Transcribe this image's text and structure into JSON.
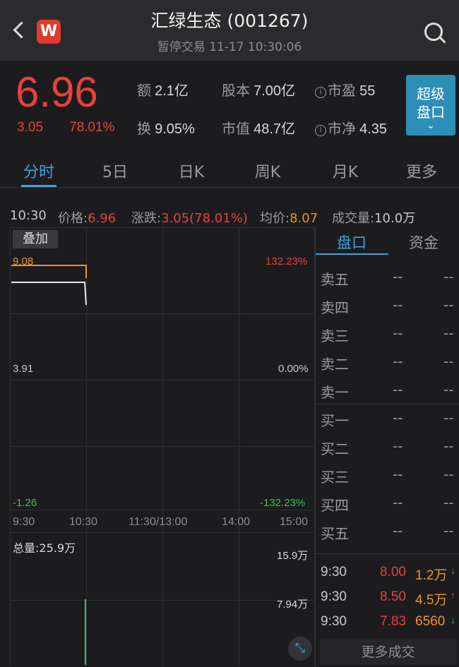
{
  "header": {
    "title": "汇绿生态 (001267)",
    "subtitle": "暂停交易 11-17 10:30:06",
    "logo_letter": "W"
  },
  "quote": {
    "price": "6.96",
    "change": "3.05",
    "change_pct": "78.01%",
    "turnover_amount_label": "额",
    "turnover_amount": "2.1亿",
    "turnover_rate_label": "换",
    "turnover_rate": "9.05%",
    "share_capital_label": "股本",
    "share_capital": "7.00亿",
    "market_value_label": "市值",
    "market_value": "48.7亿",
    "pe_label": "市盈",
    "pe": "55",
    "pb_label": "市净",
    "pb": "4.35",
    "info_glyph": "i",
    "super_book_line1": "超级",
    "super_book_line2": "盘口",
    "super_book_chevron": "⌄"
  },
  "tabs": [
    {
      "label": "分时",
      "active": true
    },
    {
      "label": "5日"
    },
    {
      "label": "日K"
    },
    {
      "label": "周K"
    },
    {
      "label": "月K"
    },
    {
      "label": "更多"
    }
  ],
  "stats": {
    "time": "10:30",
    "price_label": "价格:",
    "price": "6.96",
    "change_label": "涨跌:",
    "change": "3.05(78.01%)",
    "avg_label": "均价:",
    "avg": "8.07",
    "volume_label": "成交量:",
    "volume": "10.0万"
  },
  "chart": {
    "overlay_button": "叠加",
    "y_top": "9.08",
    "y_mid": "3.91",
    "y_bot": "-1.26",
    "pct_top": "132.23%",
    "pct_mid": "0.00%",
    "pct_bot": "-132.23%",
    "times": [
      "9:30",
      "10:30",
      "11:30/13:00",
      "14:00",
      "15:00"
    ],
    "total_volume_label": "总量:25.9万",
    "vol_top": "15.9万",
    "vol_mid": "7.94万",
    "expand_icon": "⤡"
  },
  "chart_data": {
    "type": "line",
    "x": [
      "9:30",
      "10:30"
    ],
    "series": [],
    "ylim": [
      -1.26,
      9.08
    ]
  },
  "book_tabs": [
    {
      "label": "盘口",
      "active": true
    },
    {
      "label": "资金"
    }
  ],
  "order_book": [
    {
      "label": "卖五",
      "price": "--",
      "vol": "--"
    },
    {
      "label": "卖四",
      "price": "--",
      "vol": "--"
    },
    {
      "label": "卖三",
      "price": "--",
      "vol": "--"
    },
    {
      "label": "卖二",
      "price": "--",
      "vol": "--"
    },
    {
      "label": "卖一",
      "price": "--",
      "vol": "--"
    },
    {
      "label": "买一",
      "price": "--",
      "vol": "--"
    },
    {
      "label": "买二",
      "price": "--",
      "vol": "--"
    },
    {
      "label": "买三",
      "price": "--",
      "vol": "--"
    },
    {
      "label": "买四",
      "price": "--",
      "vol": "--"
    },
    {
      "label": "买五",
      "price": "--",
      "vol": "--"
    }
  ],
  "trades": [
    {
      "time": "9:30",
      "price": "8.00",
      "vol": "1.2万",
      "dir": "↓"
    },
    {
      "time": "9:30",
      "price": "8.50",
      "vol": "4.5万",
      "dir": "↑"
    },
    {
      "time": "9:30",
      "price": "7.83",
      "vol": "6560",
      "dir": "↓"
    }
  ],
  "more_trades": "更多成交",
  "colors": {
    "up": "#e8413c",
    "accent": "#3aa6dc",
    "avg": "#f0922b",
    "down": "#3fbf5a"
  }
}
